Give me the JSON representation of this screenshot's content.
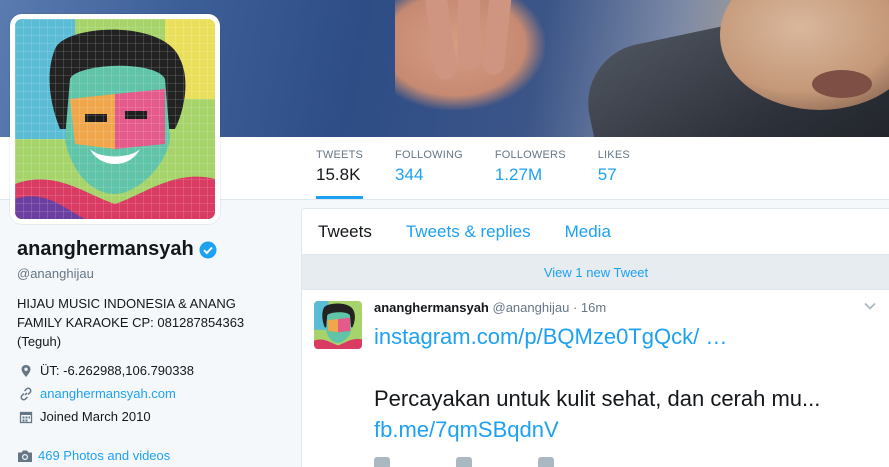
{
  "profile": {
    "display_name": "ananghermansyah",
    "handle": "@ananghijau",
    "bio": "HIJAU MUSIC INDONESIA & ANANG FAMILY KARAOKE CP: 081287854363 (Teguh)",
    "location": "ÜT: -6.262988,106.790338",
    "website": "ananghermansyah.com",
    "joined": "Joined March 2010",
    "photos": "469 Photos and videos"
  },
  "stats": [
    {
      "label": "TWEETS",
      "value": "15.8K"
    },
    {
      "label": "FOLLOWING",
      "value": "344"
    },
    {
      "label": "FOLLOWERS",
      "value": "1.27M"
    },
    {
      "label": "LIKES",
      "value": "57"
    }
  ],
  "tabs": [
    {
      "label": "Tweets"
    },
    {
      "label": "Tweets & replies"
    },
    {
      "label": "Media"
    }
  ],
  "new_tweets": "View 1 new Tweet",
  "tweet": {
    "name": "ananghermansyah",
    "handle": "@ananghijau",
    "sep": "·",
    "time": "16m",
    "link1": "instagram.com/p/BQMze0TgQck/ …",
    "text": "Percayakan untuk kulit sehat, dan cerah mu...",
    "link2": "fb.me/7qmSBqdnV"
  },
  "colors": {
    "accent": "#1da1f2",
    "muted": "#657786",
    "text": "#14171a",
    "border": "#e1e8ed"
  }
}
